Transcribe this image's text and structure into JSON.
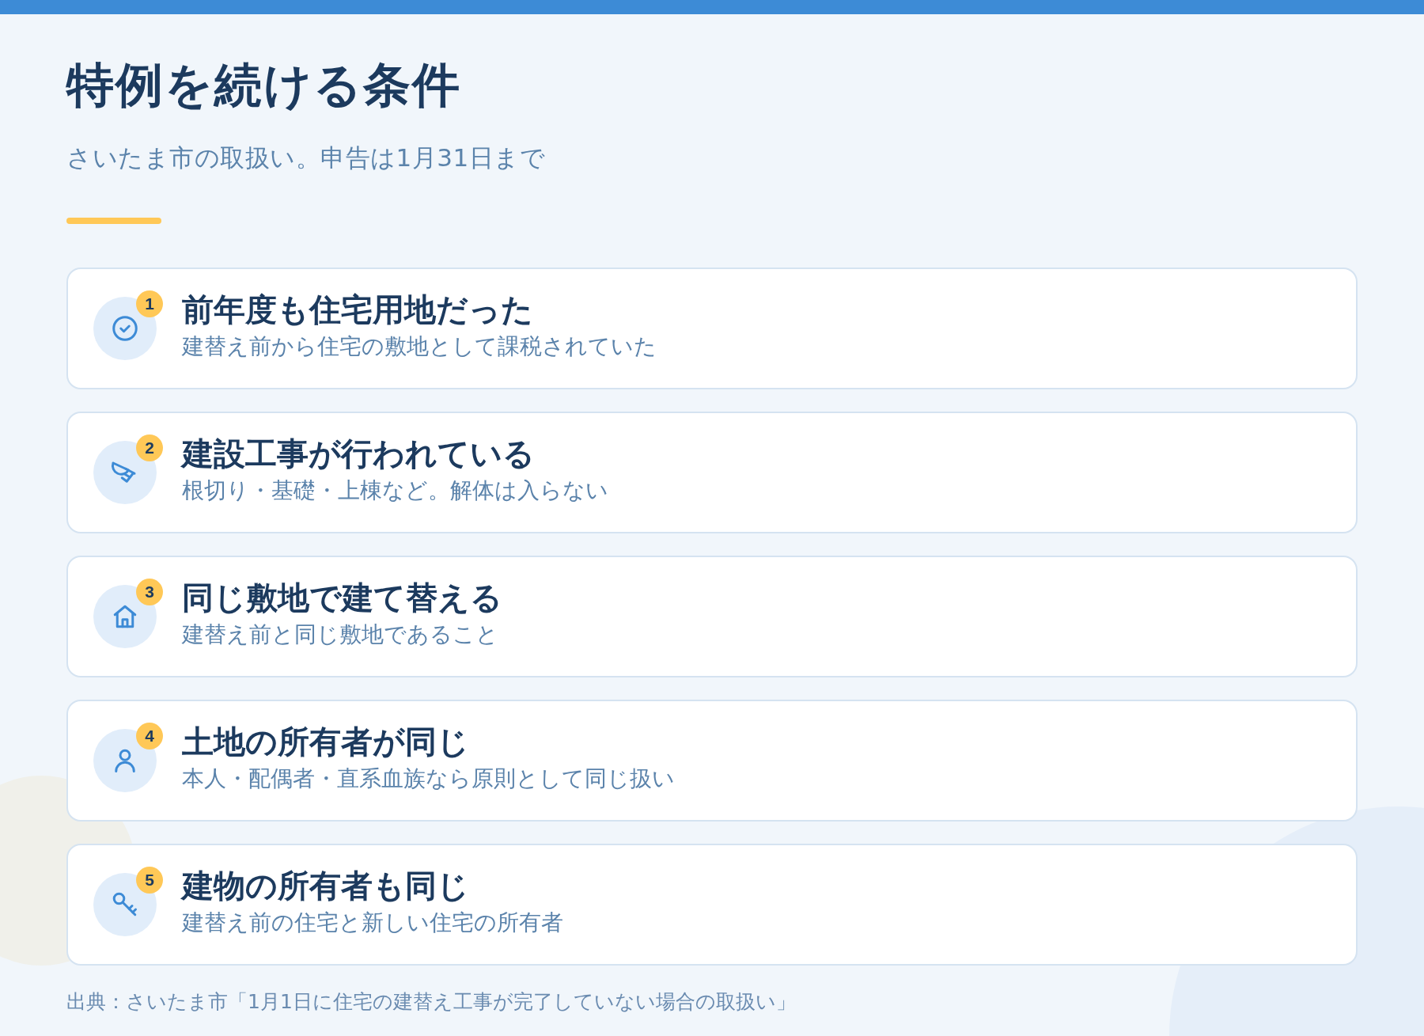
{
  "title": "特例を続ける条件",
  "subtitle": "さいたま市の取扱い。申告は1月31日まで",
  "conditions": [
    {
      "number": "1",
      "kind": "check",
      "heading": "前年度も住宅用地だった",
      "description": "建替え前から住宅の敷地として課税されていた"
    },
    {
      "number": "2",
      "kind": "bucket",
      "heading": "建設工事が行われている",
      "description": "根切り・基礎・上棟など。解体は入らない"
    },
    {
      "number": "3",
      "kind": "house",
      "heading": "同じ敷地で建て替える",
      "description": "建替え前と同じ敷地であること"
    },
    {
      "number": "4",
      "kind": "person",
      "heading": "土地の所有者が同じ",
      "description": "本人・配偶者・直系血族なら原則として同じ扱い"
    },
    {
      "number": "5",
      "kind": "key",
      "heading": "建物の所有者も同じ",
      "description": "建替え前の住宅と新しい住宅の所有者"
    }
  ],
  "source": "出典：さいたま市「1月1日に住宅の建替え工事が完了していない場合の取扱い」"
}
